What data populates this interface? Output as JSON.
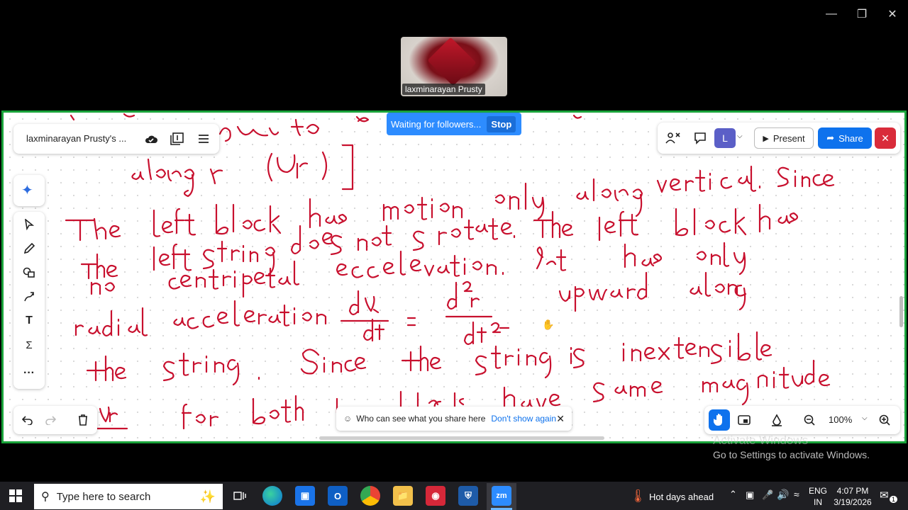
{
  "video": {
    "participant_name": "laxminarayan Prusty"
  },
  "banner": {
    "text": "Waiting for followers...",
    "stop_label": "Stop"
  },
  "board": {
    "title": "laxminarayan Prusty's ...",
    "present_label": "Present",
    "share_label": "Share",
    "avatar_letter": "L",
    "zoom_level": "100%"
  },
  "notice": {
    "text": "Who can see what you share here",
    "dont_show": "Don't show again"
  },
  "activation": {
    "title": "Activate Windows",
    "subtitle": "Go to Settings to activate Windows."
  },
  "taskbar": {
    "search_placeholder": "Type here to search",
    "weather": "Hot days ahead",
    "language": "ENG",
    "region": "IN",
    "time": "4:07 PM",
    "date": "3/19/2026",
    "notification_count": "1",
    "zoom_app_label": "zm"
  },
  "colors": {
    "accent": "#2d8cff",
    "share_border": "#19a33a",
    "ink": "#c8102e"
  }
}
